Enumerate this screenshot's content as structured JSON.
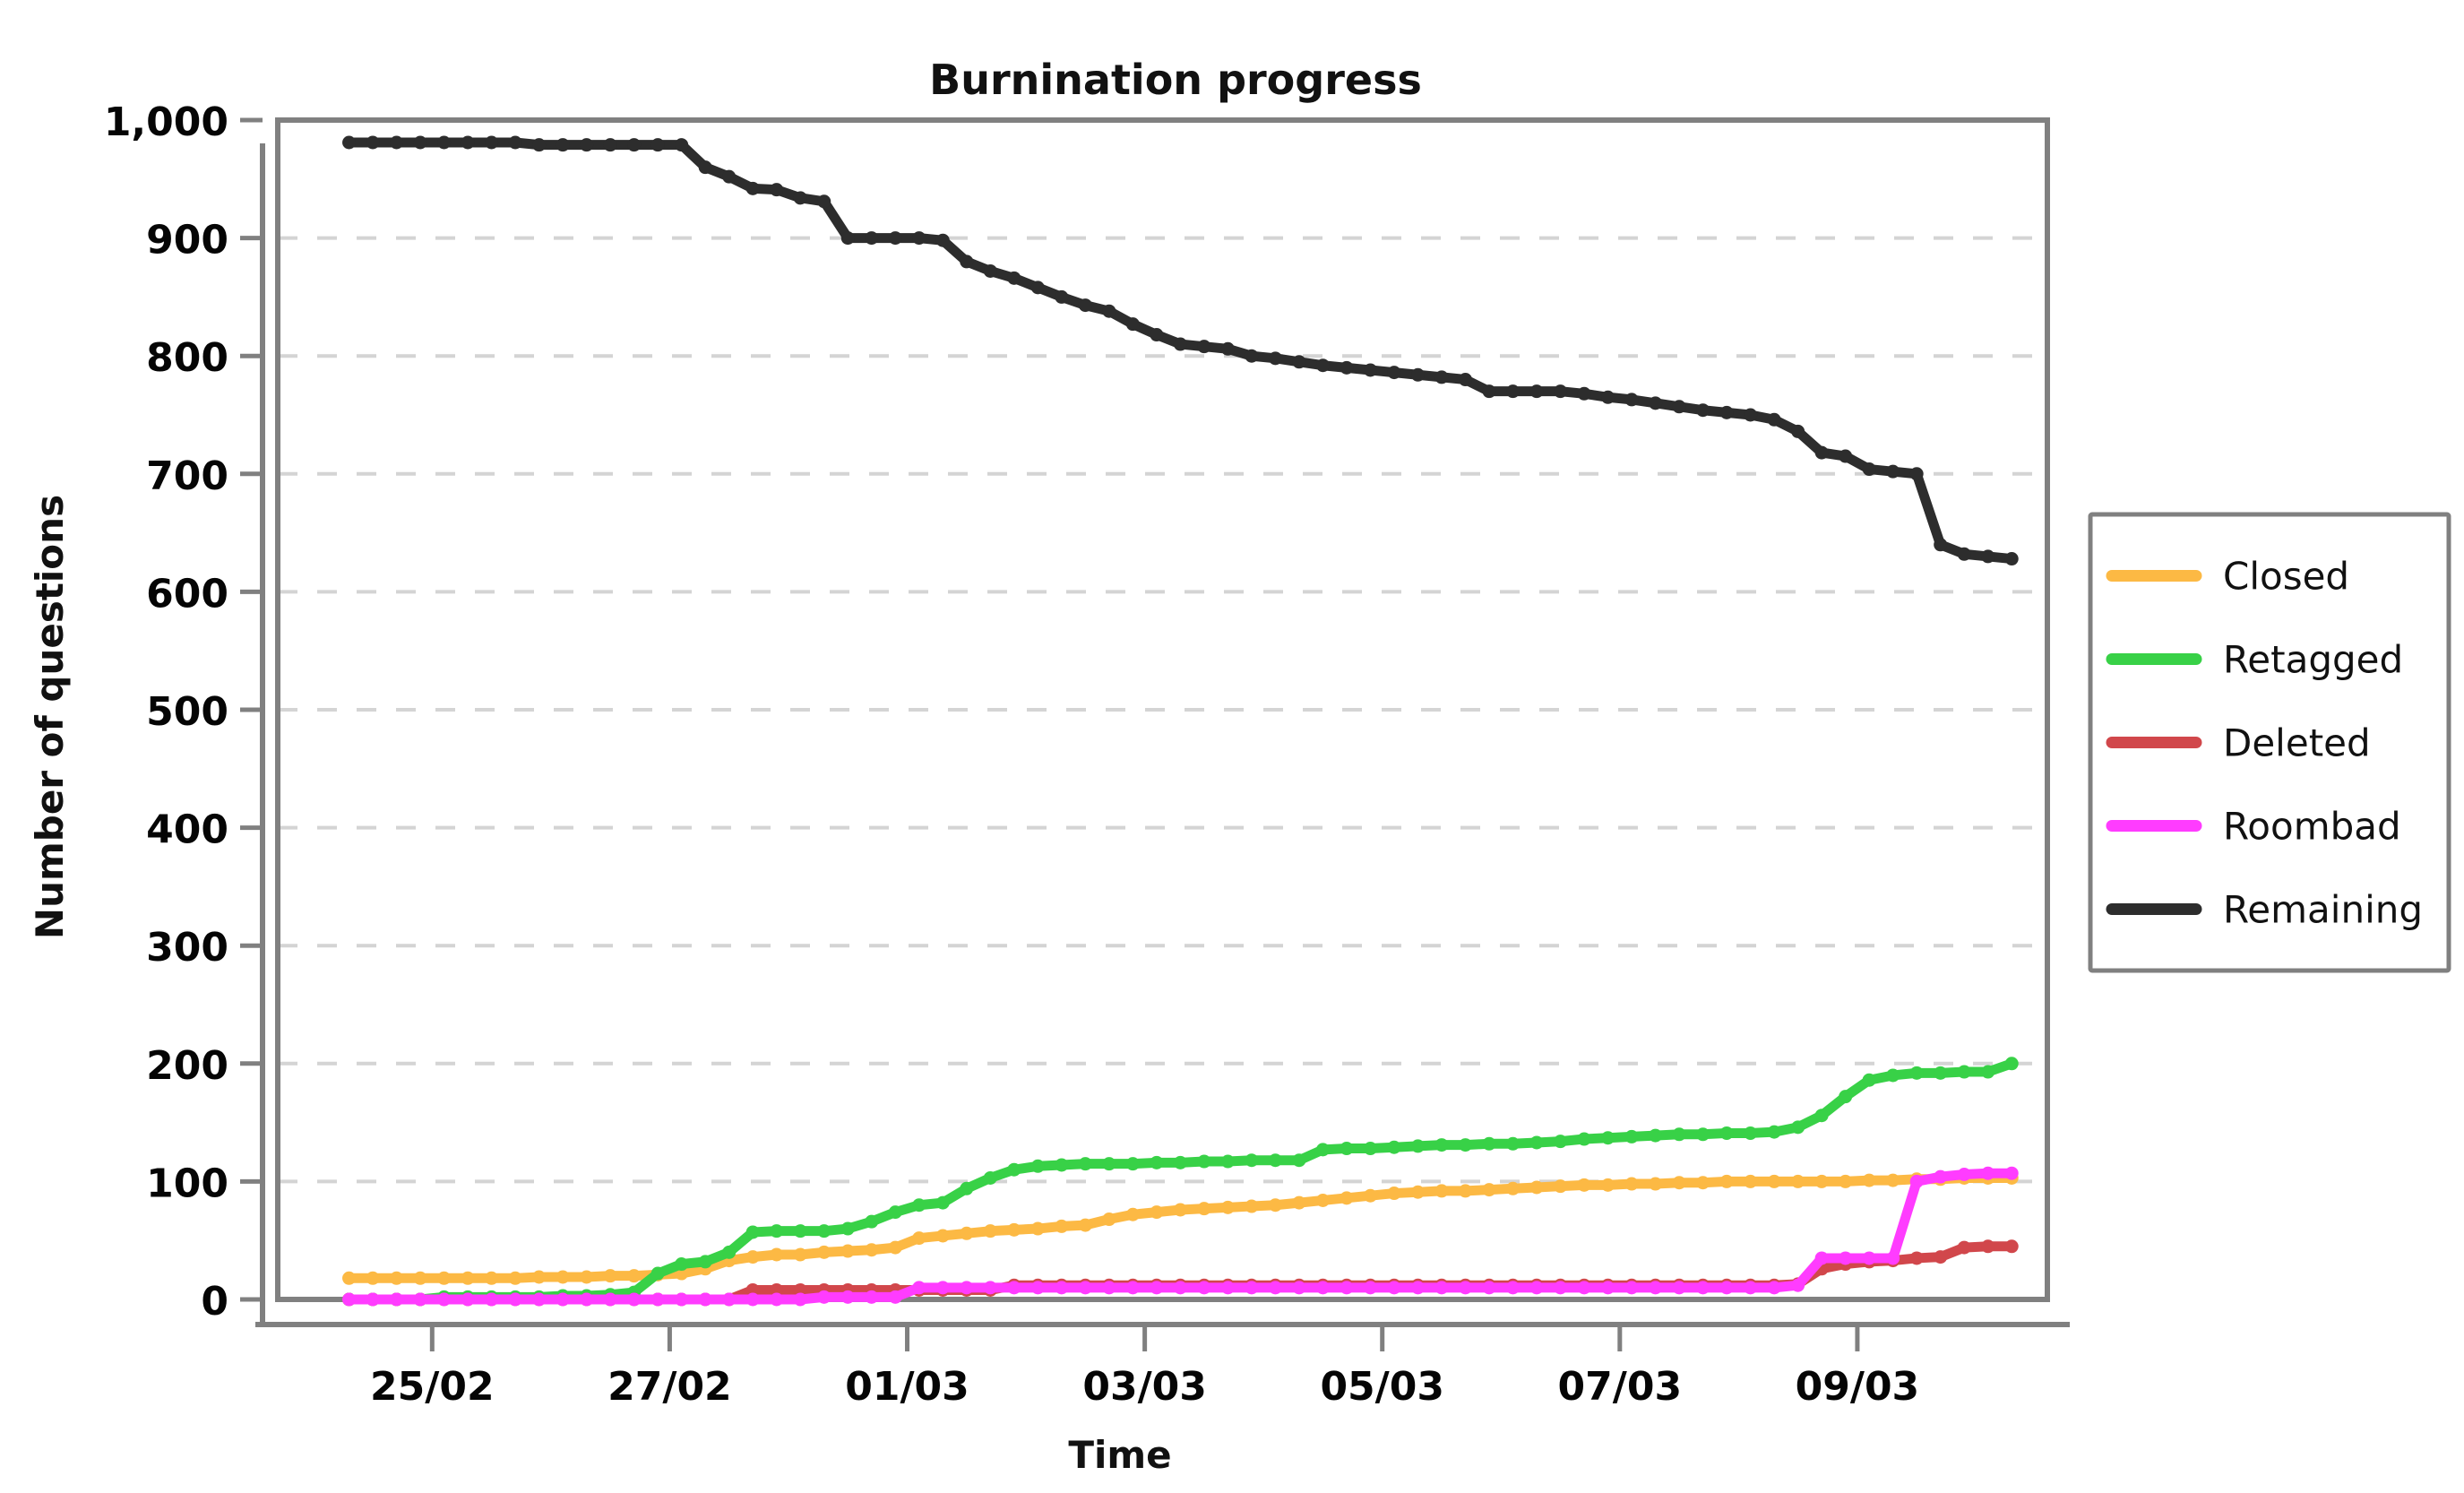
{
  "chart_data": {
    "type": "line",
    "title": "Burnination progress",
    "xlabel": "Time",
    "ylabel": "Number of questions",
    "grid": true,
    "grid_axis": "y",
    "legend_position": "right",
    "ylim": [
      0,
      1000
    ],
    "yticks": [
      0,
      100,
      200,
      300,
      400,
      500,
      600,
      700,
      800,
      900,
      1000
    ],
    "ytick_labels": [
      "0",
      "100",
      "200",
      "300",
      "400",
      "500",
      "600",
      "700",
      "800",
      "900",
      "1,000"
    ],
    "xtick_labels": [
      "25/02",
      "27/02",
      "01/03",
      "03/03",
      "05/03",
      "07/03",
      "09/03"
    ],
    "xtick_positions": [
      1.0,
      3.0,
      5.0,
      7.0,
      9.0,
      11.0,
      13.0
    ],
    "xlim": [
      -0.3,
      14.6
    ],
    "x": [
      0.3,
      0.5,
      0.7,
      0.9,
      1.1,
      1.3,
      1.5,
      1.7,
      1.9,
      2.1,
      2.3,
      2.5,
      2.7,
      2.9,
      3.1,
      3.3,
      3.5,
      3.7,
      3.9,
      4.1,
      4.3,
      4.5,
      4.7,
      4.9,
      5.1,
      5.3,
      5.5,
      5.7,
      5.9,
      6.1,
      6.3,
      6.5,
      6.7,
      6.9,
      7.1,
      7.3,
      7.5,
      7.7,
      7.9,
      8.1,
      8.3,
      8.5,
      8.7,
      8.9,
      9.1,
      9.3,
      9.5,
      9.7,
      9.9,
      10.1,
      10.3,
      10.5,
      10.7,
      10.9,
      11.1,
      11.3,
      11.5,
      11.7,
      11.9,
      12.1,
      12.3,
      12.5,
      12.7,
      12.9,
      13.1,
      13.3,
      13.5,
      13.7,
      13.9,
      14.1,
      14.3
    ],
    "series": [
      {
        "name": "Closed",
        "color": "#fcb944",
        "values": [
          18,
          18,
          18,
          18,
          18,
          18,
          18,
          18,
          19,
          19,
          19,
          20,
          20,
          21,
          22,
          26,
          33,
          36,
          38,
          38,
          40,
          41,
          42,
          44,
          52,
          54,
          56,
          58,
          59,
          60,
          62,
          63,
          68,
          72,
          74,
          76,
          77,
          78,
          79,
          80,
          82,
          84,
          86,
          88,
          90,
          91,
          92,
          92,
          93,
          94,
          95,
          96,
          97,
          97,
          98,
          98,
          99,
          99,
          100,
          100,
          100,
          100,
          100,
          100,
          101,
          101,
          102,
          102,
          103,
          103,
          103
        ]
      },
      {
        "name": "Retagged",
        "color": "#38d147",
        "values": [
          0,
          0,
          0,
          0,
          2,
          2,
          2,
          2,
          2,
          3,
          3,
          4,
          6,
          22,
          30,
          32,
          40,
          57,
          58,
          58,
          58,
          60,
          66,
          74,
          80,
          82,
          94,
          103,
          110,
          113,
          114,
          115,
          115,
          115,
          116,
          116,
          117,
          117,
          118,
          118,
          118,
          127,
          128,
          128,
          129,
          130,
          131,
          131,
          132,
          132,
          133,
          134,
          136,
          137,
          138,
          139,
          140,
          140,
          141,
          141,
          142,
          146,
          156,
          172,
          186,
          190,
          192,
          192,
          193,
          193,
          200
        ]
      },
      {
        "name": "Deleted",
        "color": "#d1474b",
        "values": [
          0,
          0,
          0,
          0,
          0,
          0,
          0,
          0,
          0,
          0,
          0,
          0,
          0,
          0,
          0,
          0,
          0,
          8,
          8,
          8,
          8,
          8,
          8,
          8,
          8,
          8,
          8,
          8,
          12,
          12,
          12,
          12,
          12,
          12,
          12,
          12,
          12,
          12,
          12,
          12,
          12,
          12,
          12,
          12,
          12,
          12,
          12,
          12,
          12,
          12,
          12,
          12,
          12,
          12,
          12,
          12,
          12,
          12,
          12,
          12,
          12,
          13,
          26,
          30,
          32,
          33,
          35,
          36,
          44,
          45,
          45
        ]
      },
      {
        "name": "Roombad",
        "color": "#ff3cff",
        "values": [
          0,
          0,
          0,
          0,
          0,
          0,
          0,
          0,
          0,
          0,
          0,
          0,
          0,
          0,
          0,
          0,
          0,
          0,
          0,
          0,
          2,
          2,
          2,
          2,
          10,
          10,
          10,
          10,
          10,
          10,
          10,
          10,
          10,
          10,
          10,
          10,
          10,
          10,
          10,
          10,
          10,
          10,
          10,
          10,
          10,
          10,
          10,
          10,
          10,
          10,
          10,
          10,
          10,
          10,
          10,
          10,
          10,
          10,
          10,
          10,
          10,
          12,
          35,
          35,
          35,
          35,
          100,
          104,
          106,
          107,
          107
        ]
      },
      {
        "name": "Remaining",
        "color": "#2d2d2d",
        "values": [
          981,
          981,
          981,
          981,
          981,
          981,
          981,
          981,
          979,
          979,
          979,
          979,
          979,
          979,
          979,
          960,
          952,
          942,
          941,
          934,
          931,
          900,
          900,
          900,
          900,
          898,
          880,
          872,
          866,
          858,
          850,
          843,
          838,
          827,
          818,
          810,
          808,
          806,
          800,
          798,
          795,
          792,
          790,
          788,
          786,
          784,
          782,
          780,
          770,
          770,
          770,
          770,
          768,
          765,
          763,
          760,
          757,
          754,
          752,
          750,
          746,
          736,
          718,
          715,
          704,
          702,
          700,
          640,
          632,
          630,
          628
        ]
      }
    ]
  }
}
